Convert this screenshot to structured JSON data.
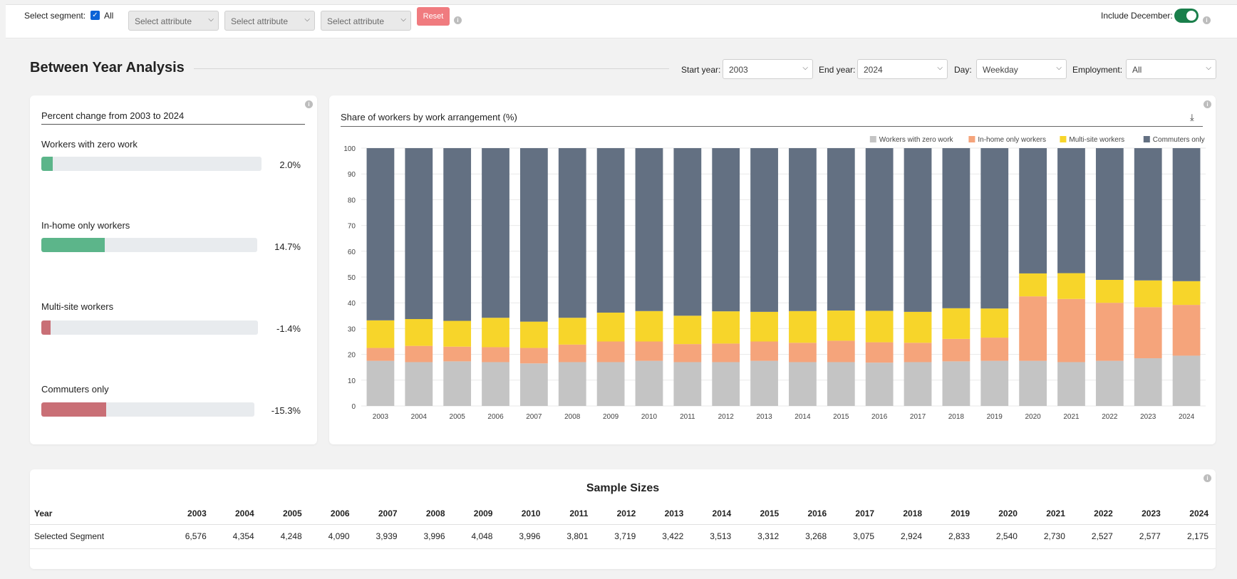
{
  "topbar": {
    "segment_label": "Select segment:",
    "all_label": "All",
    "attr_placeholder_1": "Select attribute",
    "attr_placeholder_2": "Select attribute",
    "attr_placeholder_3": "Select attribute",
    "reset_label": "Reset",
    "include_december_label": "Include December:",
    "include_december_on": true
  },
  "header": {
    "title": "Between Year Analysis",
    "start_year_label": "Start year:",
    "start_year_value": "2003",
    "end_year_label": "End year:",
    "end_year_value": "2024",
    "day_label": "Day:",
    "day_value": "Weekday",
    "employment_label": "Employment:",
    "employment_value": "All"
  },
  "percent_change": {
    "title": "Percent change from 2003 to 2024",
    "items": [
      {
        "label": "Workers with zero work",
        "value": "2.0%",
        "color": "#5cb58a"
      },
      {
        "label": "In-home only workers",
        "value": "14.7%",
        "color": "#5cb58a"
      },
      {
        "label": "Multi-site workers",
        "value": "-1.4%",
        "color": "#c96f76"
      },
      {
        "label": "Commuters only",
        "value": "-15.3%",
        "color": "#c96f76"
      }
    ]
  },
  "chart_data": {
    "type": "bar",
    "stacked": true,
    "title": "Share of workers by work arrangement (%)",
    "categories": [
      "2003",
      "2004",
      "2005",
      "2006",
      "2007",
      "2008",
      "2009",
      "2010",
      "2011",
      "2012",
      "2013",
      "2014",
      "2015",
      "2016",
      "2017",
      "2018",
      "2019",
      "2020",
      "2021",
      "2022",
      "2023",
      "2024"
    ],
    "ylim": [
      0,
      100
    ],
    "yticks": [
      0,
      10,
      20,
      30,
      40,
      50,
      60,
      70,
      80,
      90,
      100
    ],
    "legend_position": "top-right",
    "grid": true,
    "series": [
      {
        "name": "Workers with zero work",
        "color": "#c4c4c4",
        "values": [
          17.5,
          17,
          17.3,
          17,
          16.5,
          17,
          17,
          17.5,
          17,
          17,
          17.5,
          17,
          17,
          16.8,
          17,
          17.3,
          17.5,
          17.5,
          17,
          17.5,
          18.5,
          19.5
        ]
      },
      {
        "name": "In-home only workers",
        "color": "#f5a47b",
        "values": [
          5,
          6.3,
          5.7,
          5.8,
          6,
          6.8,
          8,
          7.5,
          7,
          7.2,
          7.5,
          7.5,
          8.3,
          7.9,
          7.5,
          8.7,
          9,
          25,
          24.5,
          22.5,
          19.8,
          19.7
        ]
      },
      {
        "name": "Multi-site workers",
        "color": "#f7d52a",
        "values": [
          10.7,
          10.4,
          10,
          11.4,
          10.2,
          10.4,
          11.2,
          11.8,
          11,
          12.5,
          11.5,
          12.3,
          11.7,
          12.2,
          12,
          11.9,
          11.3,
          8.9,
          10,
          8.9,
          10.4,
          9.2
        ]
      },
      {
        "name": "Commuters only",
        "color": "#637082",
        "values": [
          66.8,
          66.3,
          67,
          65.8,
          67.3,
          65.8,
          63.8,
          63.2,
          65,
          63.3,
          63.5,
          63.2,
          63,
          63.1,
          63.5,
          62.1,
          62.2,
          48.6,
          48.5,
          51.1,
          51.3,
          51.6
        ]
      }
    ]
  },
  "sample_sizes": {
    "title": "Sample Sizes",
    "year_header": "Year",
    "years": [
      "2003",
      "2004",
      "2005",
      "2006",
      "2007",
      "2008",
      "2009",
      "2010",
      "2011",
      "2012",
      "2013",
      "2014",
      "2015",
      "2016",
      "2017",
      "2018",
      "2019",
      "2020",
      "2021",
      "2022",
      "2023",
      "2024"
    ],
    "row_label": "Selected Segment",
    "values": [
      "6,576",
      "4,354",
      "4,248",
      "4,090",
      "3,939",
      "3,996",
      "4,048",
      "3,996",
      "3,801",
      "3,719",
      "3,422",
      "3,513",
      "3,312",
      "3,268",
      "3,075",
      "2,924",
      "2,833",
      "2,540",
      "2,730",
      "2,527",
      "2,577",
      "2,175"
    ]
  }
}
